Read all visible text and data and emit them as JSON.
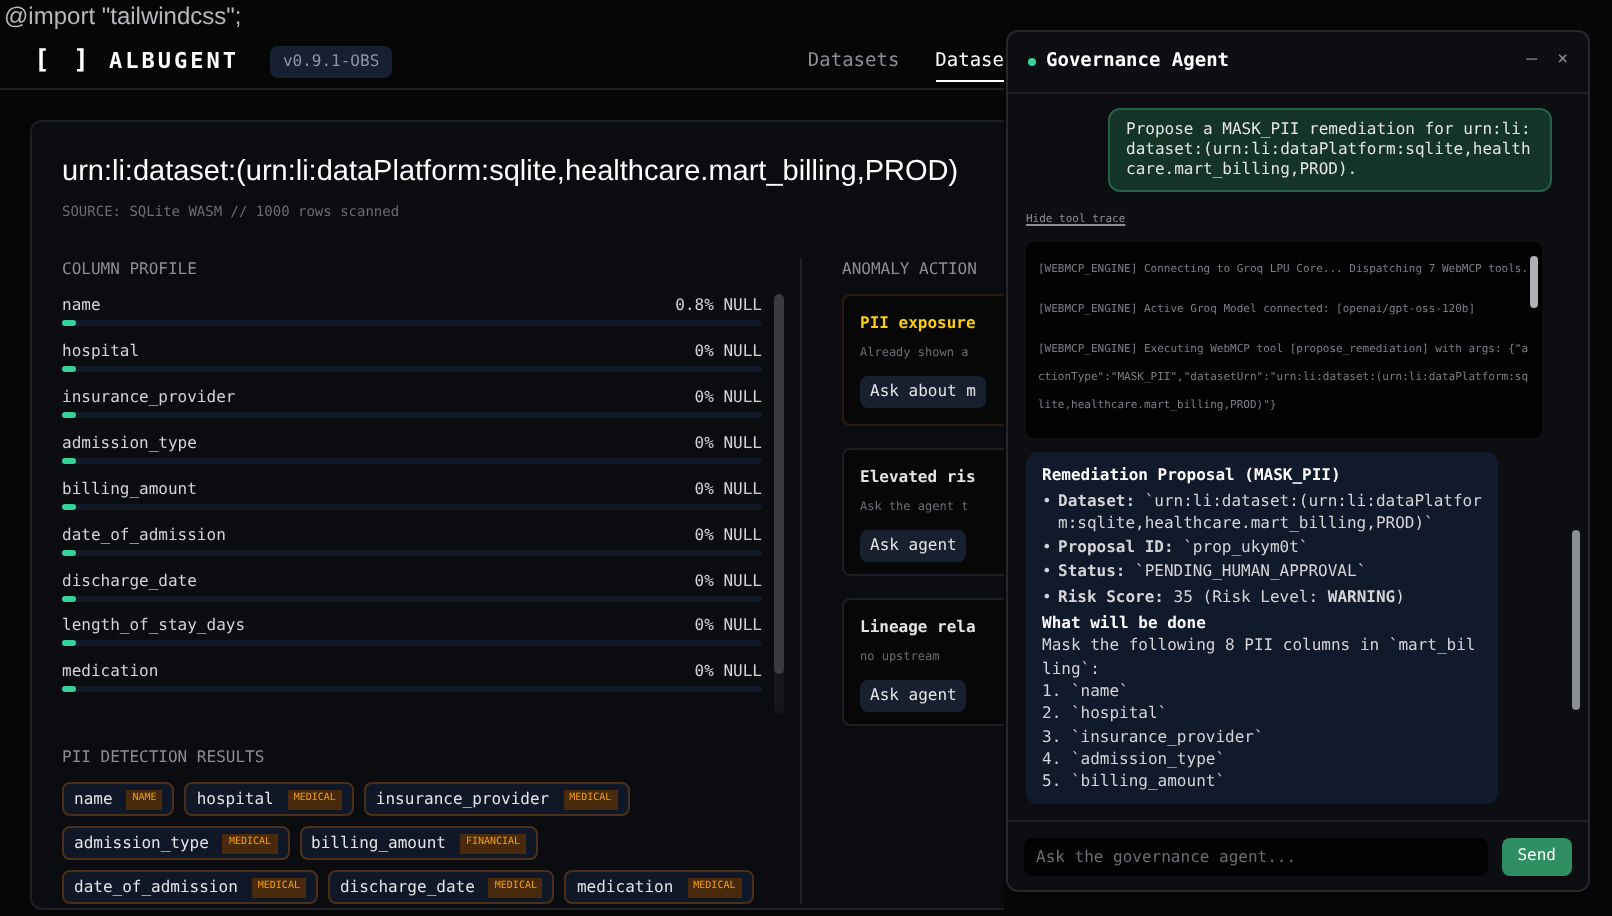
{
  "code_line": "@import \"tailwindcss\";",
  "header": {
    "logo": "[ ]",
    "brand": "ALBUGENT",
    "version": "v0.9.1-OBS",
    "nav": [
      {
        "label": "Datasets",
        "selected": false
      },
      {
        "label": "Datase",
        "selected": true
      }
    ]
  },
  "dataset": {
    "title": "urn:li:dataset:(urn:li:dataPlatform:sqlite,healthcare.mart_billing,PROD)",
    "source": "SOURCE: SQLite WASM // 1000 rows scanned"
  },
  "column_profile": {
    "heading": "COLUMN PROFILE",
    "columns": [
      {
        "name": "name",
        "reading": "0.8% NULL",
        "level": 0.02
      },
      {
        "name": "hospital",
        "reading": "0% NULL",
        "level": 0.02
      },
      {
        "name": "insurance_provider",
        "reading": "0% NULL",
        "level": 0.02
      },
      {
        "name": "admission_type",
        "reading": "0% NULL",
        "level": 0.02
      },
      {
        "name": "billing_amount",
        "reading": "0% NULL",
        "level": 0.02
      },
      {
        "name": "date_of_admission",
        "reading": "0% NULL",
        "level": 0.02
      },
      {
        "name": "discharge_date",
        "reading": "0% NULL",
        "level": 0.02
      },
      {
        "name": "length_of_stay_days",
        "reading": "0% NULL",
        "level": 0.02
      },
      {
        "name": "medication",
        "reading": "0% NULL",
        "level": 0.02
      }
    ]
  },
  "pii_results": {
    "heading": "PII DETECTION RESULTS",
    "rows": [
      [
        {
          "column": "name",
          "tag": "NAME"
        },
        {
          "column": "hospital",
          "tag": "MEDICAL"
        },
        {
          "column": "insurance_provider",
          "tag": "MEDICAL"
        }
      ],
      [
        {
          "column": "admission_type",
          "tag": "MEDICAL"
        },
        {
          "column": "billing_amount",
          "tag": "FINANCIAL"
        }
      ],
      [
        {
          "column": "date_of_admission",
          "tag": "MEDICAL"
        },
        {
          "column": "discharge_date",
          "tag": "MEDICAL"
        },
        {
          "column": "medication",
          "tag": "MEDICAL"
        }
      ]
    ]
  },
  "anomaly_actions": {
    "heading": "ANOMALY ACTION",
    "items": [
      {
        "title": "PII exposure",
        "highlighted": true,
        "description": "Already shown a",
        "button": "Ask about m"
      },
      {
        "title": "Elevated ris",
        "highlighted": false,
        "description": "Ask the agent t",
        "button": "Ask agent"
      },
      {
        "title": "Lineage rela",
        "highlighted": false,
        "description": "no upstream",
        "button": "Ask agent"
      }
    ]
  },
  "agent_panel": {
    "title": "Governance Agent",
    "online": true,
    "minimize": "–",
    "close": "×",
    "user_message": "Propose a MASK_PII remediation for urn:li:dataset:(urn:li:dataPlatform:sqlite,healthcare.mart_billing,PROD).",
    "trace_toggle": "Hide tool trace",
    "trace": [
      "[WEBMCP_ENGINE] Connecting to Groq LPU Core... Dispatching 7 WebMCP tools.",
      "[WEBMCP_ENGINE] Active Groq Model connected: [openai/gpt-oss-120b]",
      "[WEBMCP_ENGINE] Executing WebMCP tool [propose_remediation] with args: {\"actionType\":\"MASK_PII\",\"datasetUrn\":\"urn:li:dataset:(urn:li:dataPlatform:sqlite,healthcare.mart_billing,PROD)\"}"
    ],
    "proposal": {
      "title": "Remediation Proposal (MASK_PII)",
      "bullet": "•",
      "bullets": [
        "**Dataset:** `urn:li:dataset:(urn:li:dataPlatform:sqlite,healthcare.mart_billing,PROD)`",
        "**Proposal ID:** `prop_ukym0t`",
        "**Status:** `PENDING_HUMAN_APPROVAL`",
        "**Risk Score:** 35 (Risk Level: **WARNING**)"
      ],
      "subheading": "What will be done",
      "text": "Mask the following 8 PII columns in `mart_billing`:",
      "list": [
        "1. `name`",
        "2. `hospital`",
        "3. `insurance_provider`",
        "4. `admission_type`",
        "5. `billing_amount`"
      ]
    },
    "input_placeholder": "Ask the governance agent...",
    "send": "Send"
  }
}
